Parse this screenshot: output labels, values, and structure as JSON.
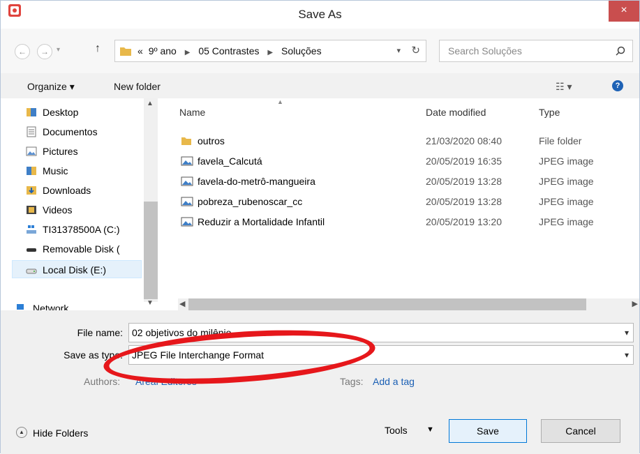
{
  "window": {
    "title": "Save As",
    "close": "×"
  },
  "nav": {
    "back": "←",
    "forward": "→",
    "up": "↑",
    "breadcrumbs": [
      "9º ano",
      "05 Contrastes",
      "Soluções"
    ],
    "overflow": "«",
    "search_placeholder": "Search Soluções"
  },
  "toolbar": {
    "organize": "Organize ▾",
    "new_folder": "New folder",
    "view": "☷ ▾",
    "help": "?"
  },
  "sidebar": {
    "items": [
      {
        "label": "Desktop"
      },
      {
        "label": "Documentos"
      },
      {
        "label": "Pictures"
      },
      {
        "label": "Music"
      },
      {
        "label": "Downloads"
      },
      {
        "label": "Videos"
      },
      {
        "label": "TI31378500A (C:)"
      },
      {
        "label": "Removable Disk ("
      },
      {
        "label": "Local Disk (E:)",
        "selected": true
      },
      {
        "label": "Network"
      }
    ]
  },
  "columns": {
    "name": "Name",
    "date": "Date modified",
    "type": "Type"
  },
  "files": [
    {
      "name": "outros",
      "date": "21/03/2020 08:40",
      "type": "File folder",
      "icon": "folder-icon"
    },
    {
      "name": "favela_Calcutá",
      "date": "20/05/2019 16:35",
      "type": "JPEG image",
      "icon": "image-file-icon"
    },
    {
      "name": "favela-do-metrô-mangueira",
      "date": "20/05/2019 13:28",
      "type": "JPEG image",
      "icon": "image-file-icon"
    },
    {
      "name": "pobreza_rubenoscar_cc",
      "date": "20/05/2019 13:28",
      "type": "JPEG image",
      "icon": "image-file-icon"
    },
    {
      "name": "Reduzir a Mortalidade Infantil",
      "date": "20/05/2019 13:20",
      "type": "JPEG image",
      "icon": "image-file-icon"
    }
  ],
  "form": {
    "file_name_label": "File name:",
    "file_name_value": "02 objetivos do milênio",
    "save_type_label": "Save as type:",
    "save_type_value": "JPEG File Interchange Format",
    "authors_label": "Authors:",
    "authors_value": "Areal Editores",
    "tags_label": "Tags:",
    "tags_value": "Add a tag"
  },
  "footer": {
    "hide_folders": "Hide Folders",
    "tools": "Tools",
    "save": "Save",
    "cancel": "Cancel"
  },
  "colors": {
    "highlight_ring": "#e6171b",
    "close": "#c94e4e",
    "link": "#1a5fb4"
  }
}
